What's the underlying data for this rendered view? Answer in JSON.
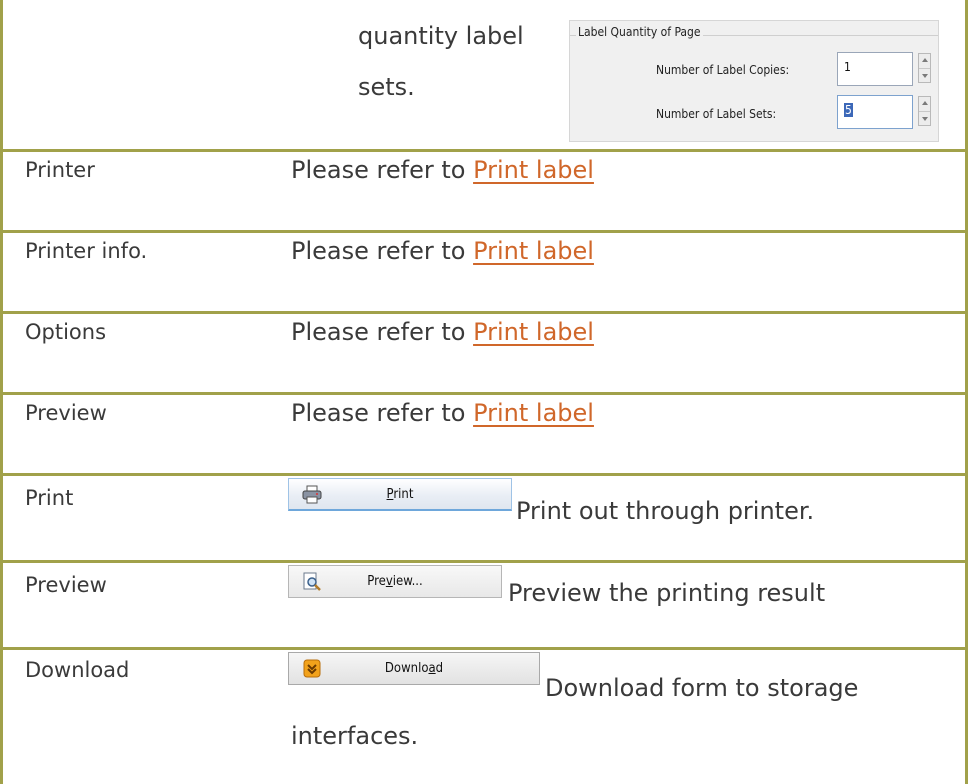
{
  "top_row": {
    "line1": "quantity label",
    "line2": "sets.",
    "dialog": {
      "group_title": "Label Quantity of Page",
      "copies_label": "Number of Label Copies:",
      "copies_value": "1",
      "sets_label": "Number of Label Sets:",
      "sets_value": "5"
    }
  },
  "rows": [
    {
      "label": "Printer",
      "prefix": "Please refer to ",
      "link": "Print label"
    },
    {
      "label": "Printer info.",
      "prefix": "Please refer to ",
      "link": "Print label"
    },
    {
      "label": "Options",
      "prefix": "Please refer to ",
      "link": "Print label"
    },
    {
      "label": "Preview",
      "prefix": "Please refer to ",
      "link": "Print label"
    }
  ],
  "print_row": {
    "label": "Print",
    "button_pre": "",
    "button_mnemonic": "P",
    "button_post": "rint",
    "button_icon": "printer-icon",
    "desc": "Print out through printer."
  },
  "preview_row": {
    "label": "Preview",
    "button_pre": "Pre",
    "button_mnemonic": "v",
    "button_post": "iew...",
    "button_icon": "magnifier-document-icon",
    "desc": "Preview the printing result"
  },
  "download_row": {
    "label": "Download",
    "button_pre": "Downlo",
    "button_mnemonic": "a",
    "button_post": "d",
    "button_icon": "download-icon",
    "desc_line1": "Download form to storage",
    "desc_line2": "interfaces."
  },
  "colors": {
    "border": "#a1a14a",
    "link": "#d0672a",
    "text": "#3a3a3a"
  }
}
